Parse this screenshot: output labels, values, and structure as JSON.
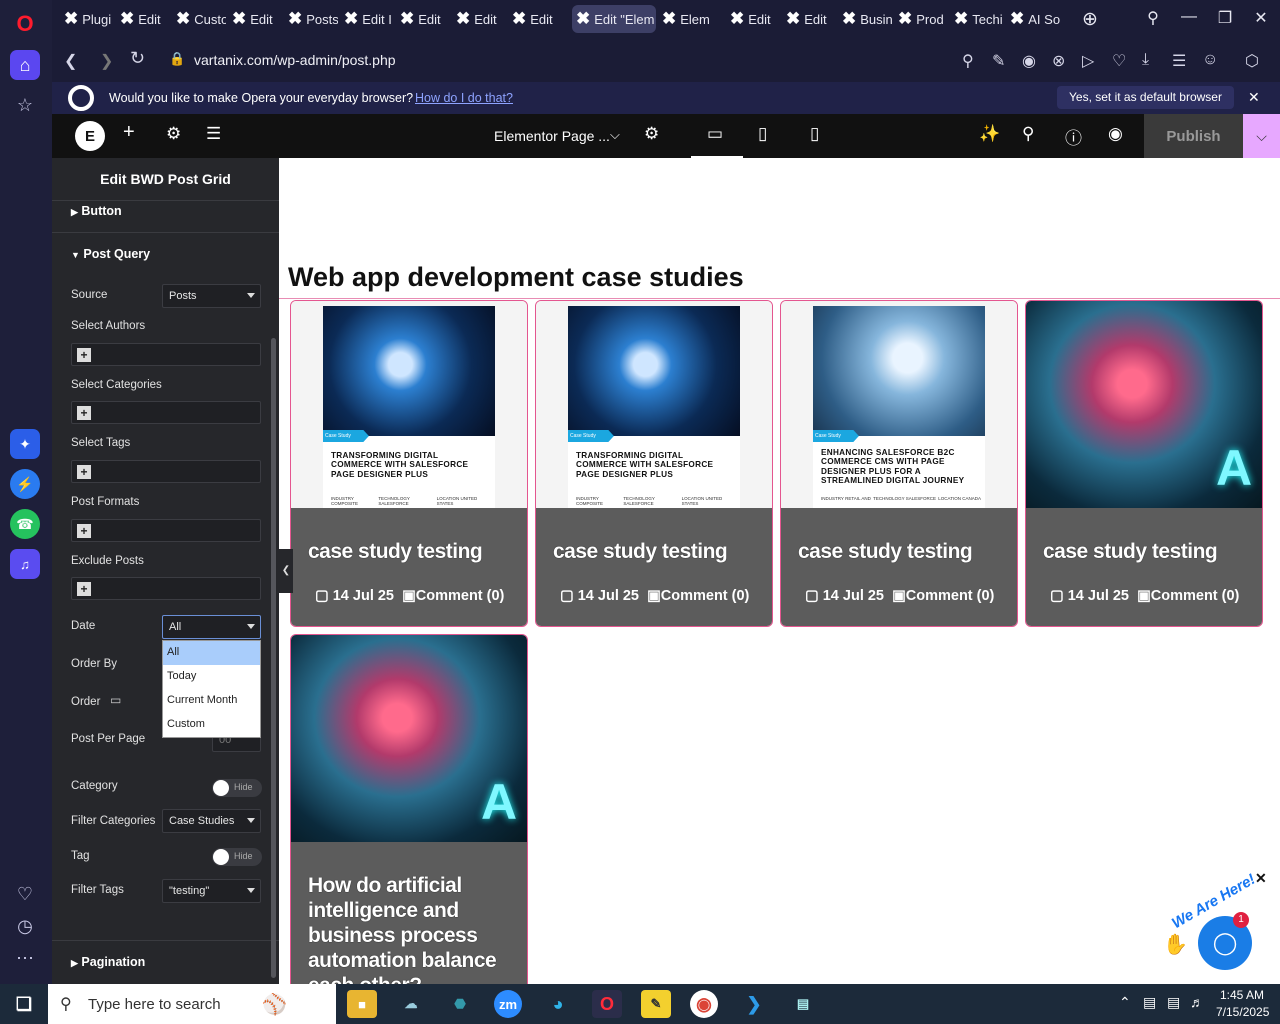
{
  "tabs": [
    "Plugi",
    "Edit",
    "Custo",
    "Edit",
    "Posts",
    "Edit I",
    "Edit",
    "Edit",
    "Edit",
    "Edit \"Elem",
    "Elem",
    "Edit",
    "Edit",
    "Busin",
    "Prod",
    "Techi",
    "AI So"
  ],
  "address": {
    "url": "vartanix.com/wp-admin/post.php"
  },
  "default_bar": {
    "prompt": "Would you like to make Opera your everyday browser?",
    "link": "How do I do that?",
    "button": "Yes, set it as default browser"
  },
  "elementor": {
    "page_menu": "Elementor Page ...",
    "publish": "Publish"
  },
  "panel": {
    "title": "Edit BWD Post Grid",
    "sections": {
      "button": "Button",
      "post_query": "Post Query",
      "pagination": "Pagination"
    },
    "fields": {
      "source": "Source",
      "source_value": "Posts",
      "select_authors": "Select Authors",
      "select_categories": "Select Categories",
      "select_tags": "Select Tags",
      "post_formats": "Post Formats",
      "exclude_posts": "Exclude Posts",
      "date": "Date",
      "date_value": "All",
      "order_by": "Order By",
      "order": "Order",
      "post_per_page": "Post Per Page",
      "post_per_page_value": "00",
      "category": "Category",
      "category_toggle": "Hide",
      "filter_categories": "Filter Categories",
      "filter_categories_value": "Case Studies",
      "tag": "Tag",
      "tag_toggle": "Hide",
      "filter_tags": "Filter Tags",
      "filter_tags_value": "\"testing\""
    },
    "date_options": [
      "All",
      "Today",
      "Current Month",
      "Custom"
    ]
  },
  "canvas": {
    "heading": "Web app development case studies",
    "cards": [
      {
        "title": "case study testing",
        "date": "14 Jul 25",
        "comments": "Comment (0)",
        "cover_tag": "Case Study",
        "cover_title": "TRANSFORMING DIGITAL COMMERCE WITH SALESFORCE PAGE DESIGNER PLUS",
        "cover_info": [
          "INDUSTRY COMPOSITE",
          "TECHNOLOGY SALESFORCE",
          "LOCATION UNITED STATES"
        ]
      },
      {
        "title": "case study testing",
        "date": "14 Jul 25",
        "comments": "Comment (0)",
        "cover_tag": "Case Study",
        "cover_title": "TRANSFORMING DIGITAL COMMERCE WITH SALESFORCE PAGE DESIGNER PLUS",
        "cover_info": [
          "INDUSTRY COMPOSITE",
          "TECHNOLOGY SALESFORCE",
          "LOCATION UNITED STATES"
        ]
      },
      {
        "title": "case study testing",
        "date": "14 Jul 25",
        "comments": "Comment (0)",
        "cover_tag": "Case Study",
        "cover_title": "ENHANCING SALESFORCE B2C COMMERCE CMS WITH PAGE DESIGNER PLUS FOR A STREAMLINED DIGITAL JOURNEY",
        "cover_info": [
          "INDUSTRY RETAIL AND",
          "TECHNOLOGY SALESFORCE",
          "LOCATION CANADA"
        ]
      },
      {
        "title": "case study testing",
        "date": "14 Jul 25",
        "comments": "Comment (0)"
      },
      {
        "title": "How do artificial intelligence and business process automation balance each other?"
      }
    ]
  },
  "chat_widget": {
    "text": "We Are Here!",
    "badge": "1"
  },
  "taskbar": {
    "search_placeholder": "Type here to search",
    "time": "1:45 AM",
    "date": "7/15/2025",
    "zoom_label": "zm"
  }
}
